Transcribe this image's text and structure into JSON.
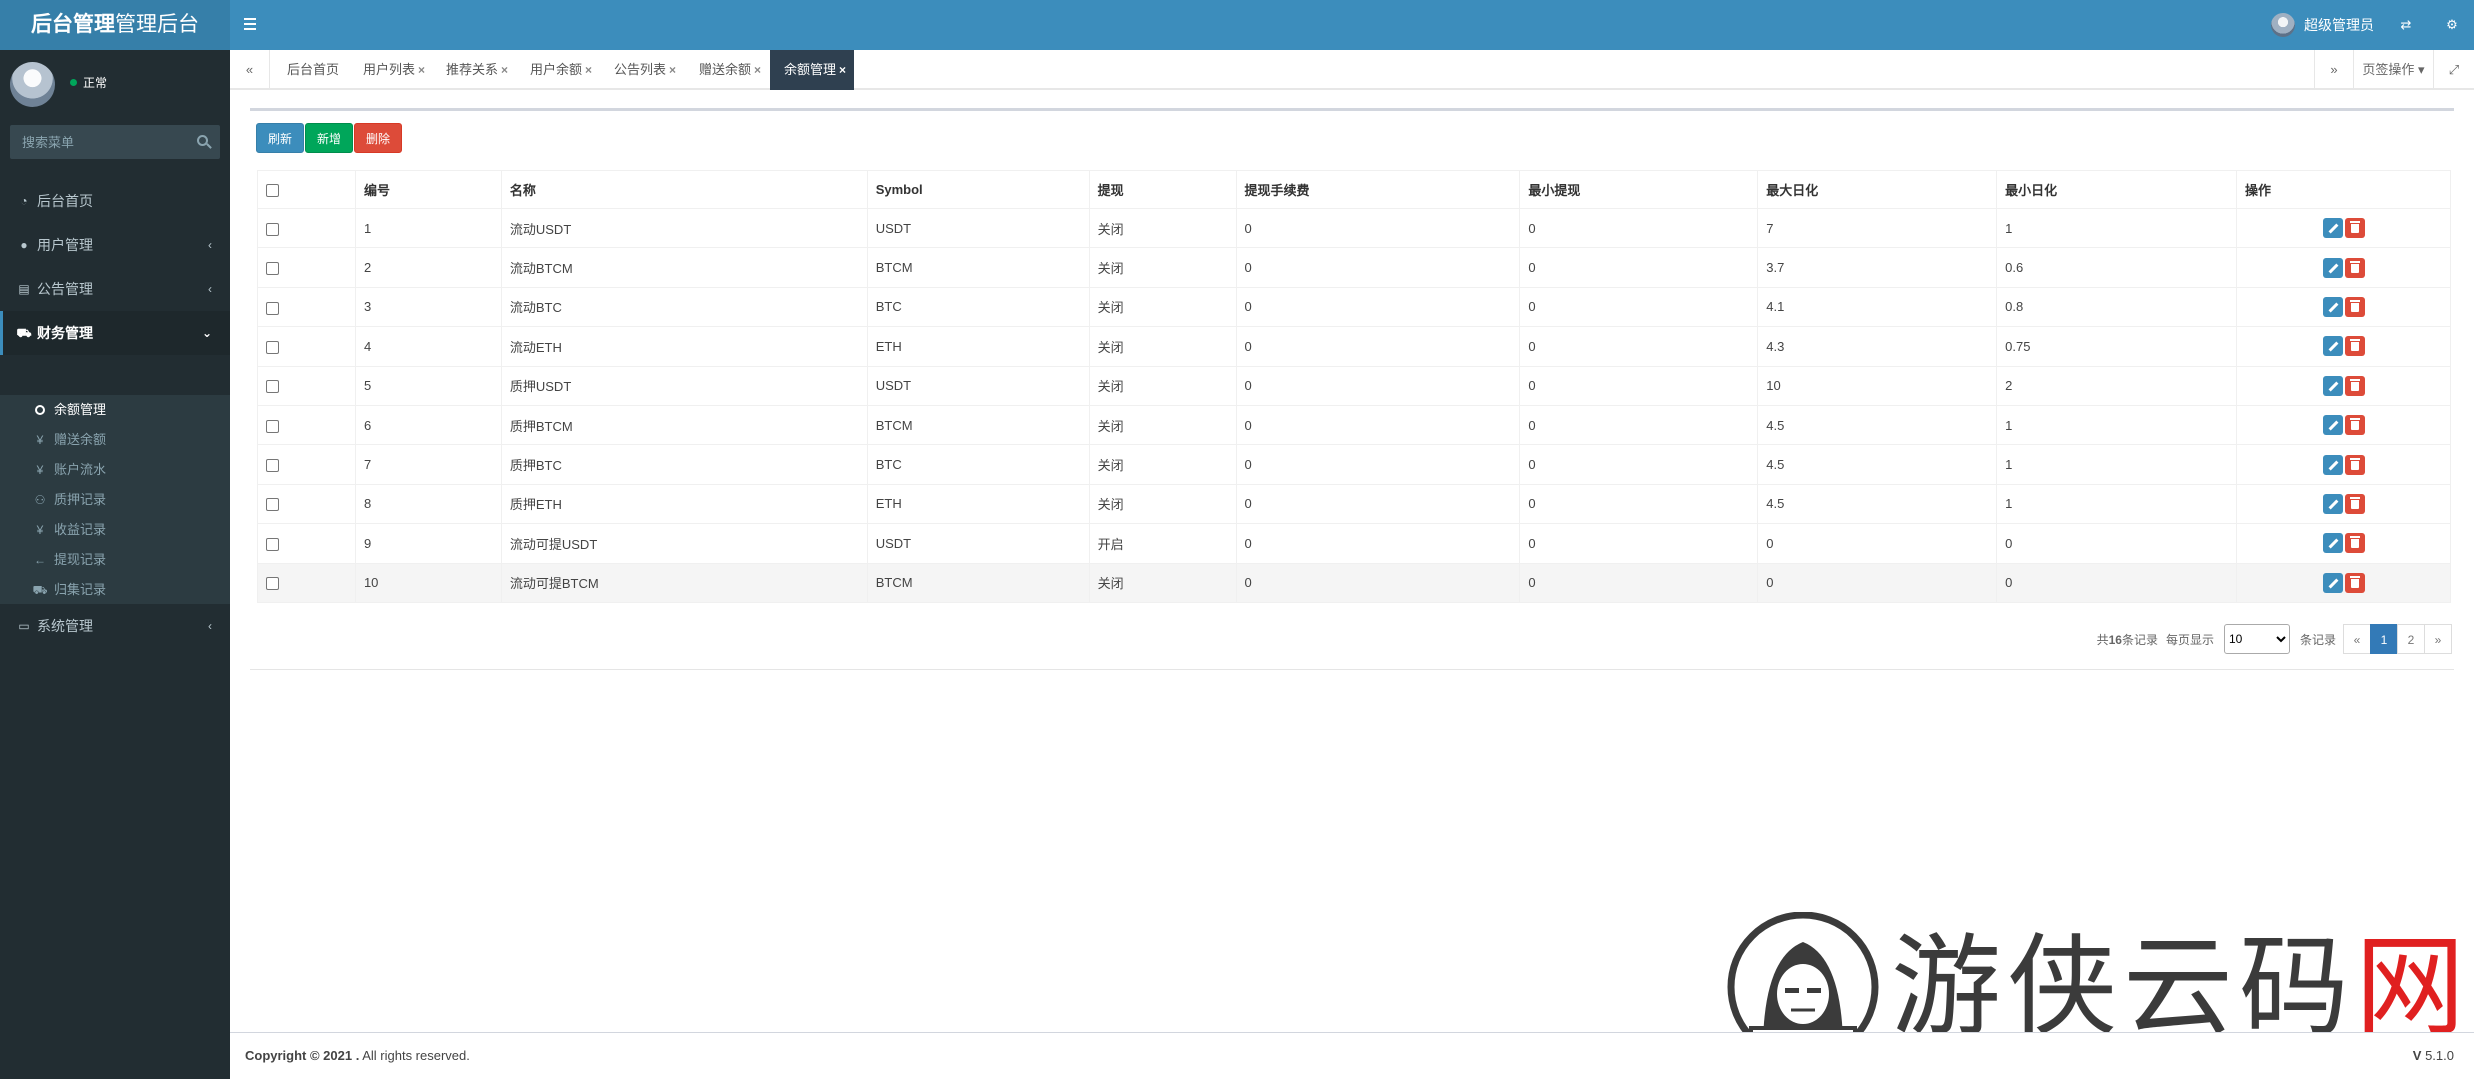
{
  "header": {
    "logo_bold": "后台管理",
    "logo_light": "管理后台",
    "user_name": "超级管理员"
  },
  "sidebar": {
    "status": "正常",
    "search_placeholder": "搜索菜单",
    "menu": [
      {
        "label": "后台首页",
        "icon": "dashboard-icon"
      },
      {
        "label": "用户管理",
        "icon": "user-icon"
      },
      {
        "label": "公告管理",
        "icon": "file-icon"
      },
      {
        "label": "财务管理",
        "icon": "car-icon"
      },
      {
        "label": "系统管理",
        "icon": "desktop-icon"
      }
    ],
    "submenu": [
      {
        "label": "余额管理",
        "icon": "circle-o-icon"
      },
      {
        "label": "赠送余额",
        "icon": "yen-icon"
      },
      {
        "label": "账户流水",
        "icon": "yen-icon"
      },
      {
        "label": "质押记录",
        "icon": "motorcycle-icon"
      },
      {
        "label": "收益记录",
        "icon": "yen-icon"
      },
      {
        "label": "提现记录",
        "icon": "arrow-left-icon"
      },
      {
        "label": "归集记录",
        "icon": "truck-icon"
      }
    ]
  },
  "tabs": {
    "items": [
      {
        "label": "后台首页",
        "closable": false
      },
      {
        "label": "用户列表",
        "closable": true
      },
      {
        "label": "推荐关系",
        "closable": true
      },
      {
        "label": "用户余额",
        "closable": true
      },
      {
        "label": "公告列表",
        "closable": true
      },
      {
        "label": "赠送余额",
        "closable": true
      },
      {
        "label": "余额管理",
        "closable": true
      }
    ],
    "page_ops": "页签操作"
  },
  "toolbar": {
    "refresh": "刷新",
    "add": "新增",
    "delete": "删除"
  },
  "table": {
    "columns": [
      "编号",
      "名称",
      "Symbol",
      "提现",
      "提现手续费",
      "最小提现",
      "最大日化",
      "最小日化",
      "操作"
    ],
    "rows": [
      [
        "1",
        "流动USDT",
        "USDT",
        "关闭",
        "0",
        "0",
        "7",
        "1"
      ],
      [
        "2",
        "流动BTCM",
        "BTCM",
        "关闭",
        "0",
        "0",
        "3.7",
        "0.6"
      ],
      [
        "3",
        "流动BTC",
        "BTC",
        "关闭",
        "0",
        "0",
        "4.1",
        "0.8"
      ],
      [
        "4",
        "流动ETH",
        "ETH",
        "关闭",
        "0",
        "0",
        "4.3",
        "0.75"
      ],
      [
        "5",
        "质押USDT",
        "USDT",
        "关闭",
        "0",
        "0",
        "10",
        "2"
      ],
      [
        "6",
        "质押BTCM",
        "BTCM",
        "关闭",
        "0",
        "0",
        "4.5",
        "1"
      ],
      [
        "7",
        "质押BTC",
        "BTC",
        "关闭",
        "0",
        "0",
        "4.5",
        "1"
      ],
      [
        "8",
        "质押ETH",
        "ETH",
        "关闭",
        "0",
        "0",
        "4.5",
        "1"
      ],
      [
        "9",
        "流动可提USDT",
        "USDT",
        "开启",
        "0",
        "0",
        "0",
        "0"
      ],
      [
        "10",
        "流动可提BTCM",
        "BTCM",
        "关闭",
        "0",
        "0",
        "0",
        "0"
      ]
    ]
  },
  "pagination": {
    "total_prefix": "共",
    "total": "16",
    "total_suffix": "条记录",
    "per_page_label": "每页显示",
    "per_page": "10",
    "per_page_suffix": "条记录",
    "prev": "«",
    "pages": [
      "1",
      "2"
    ],
    "next": "»"
  },
  "watermark": {
    "text_main": "游侠云码",
    "text_red": "网"
  },
  "footer": {
    "copyright_bold": "Copyright © 2021 .",
    "copyright_rest": " All rights reserved.",
    "version_label": "V",
    "version": " 5.1.0"
  }
}
